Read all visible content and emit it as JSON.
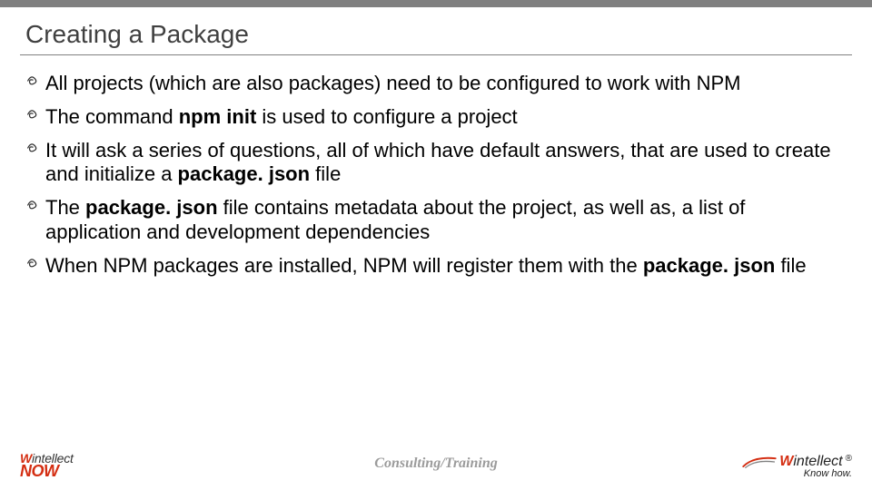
{
  "title": "Creating a Package",
  "bullets": [
    {
      "html": "All projects (which are also packages) need to be configured to work with NPM"
    },
    {
      "html": "The command <b>npm init</b> is used to configure a project"
    },
    {
      "html": "It will ask a series of questions, all of which have default answers, that are used to create and initialize a <b>package. json</b> file"
    },
    {
      "html": "The <b>package. json</b> file contains metadata about the project, as well as, a list of application and development dependencies"
    },
    {
      "html": "When NPM packages are installed, NPM will register them with the <b>package. json</b> file"
    }
  ],
  "footer": {
    "center": "Consulting/Training",
    "left_logo_line1_prefix": "W",
    "left_logo_line1_suffix": "intellect",
    "left_logo_line2": "NOW",
    "right_logo_prefix": "W",
    "right_logo_suffix": "intellect",
    "right_logo_reg": "®",
    "right_logo_tagline": "Know how."
  }
}
